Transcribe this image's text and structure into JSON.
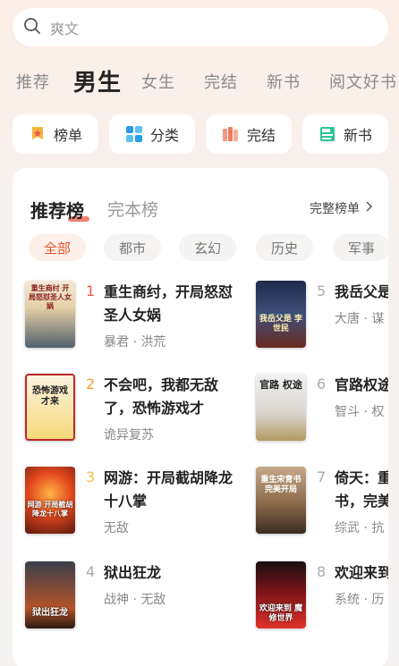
{
  "search": {
    "placeholder": "爽文"
  },
  "tabs": [
    "推荐",
    "男生",
    "女生",
    "完结",
    "新书",
    "阅文好书"
  ],
  "active_tab": "男生",
  "quick_links": [
    {
      "label": "榜单",
      "icon": "ranking-icon"
    },
    {
      "label": "分类",
      "icon": "category-grid-icon"
    },
    {
      "label": "完结",
      "icon": "finished-books-icon"
    },
    {
      "label": "新书",
      "icon": "new-book-icon"
    }
  ],
  "rank": {
    "tabs": [
      "推荐榜",
      "完本榜"
    ],
    "full_list": "完整榜单",
    "chips": [
      "全部",
      "都市",
      "玄幻",
      "历史",
      "军事"
    ],
    "books": [
      {
        "rank": "1",
        "title": "重生商纣，开局怒怼圣人女娲",
        "tag1": "暴君",
        "tag2": "洪荒",
        "cover_text": "重生商纣 开局怒怼圣人女娲"
      },
      {
        "rank": "2",
        "title": "不会吧，我都无敌了，恐怖游戏才",
        "tag1": "诡异复苏",
        "tag2": "",
        "cover_text": "恐怖游戏 才来"
      },
      {
        "rank": "3",
        "title": "网游：开局截胡降龙十八掌",
        "tag1": "无敌",
        "tag2": "",
        "cover_text": "网游 开局截胡 降龙十八掌"
      },
      {
        "rank": "4",
        "title": "狱出狂龙",
        "tag1": "战神",
        "tag2": "无敌",
        "cover_text": "狱出狂龙"
      },
      {
        "rank": "5",
        "title": "我岳父是",
        "tag1": "大唐",
        "tag2": "谋",
        "cover_text": "我岳父是 李世民"
      },
      {
        "rank": "6",
        "title": "官路权途",
        "tag1": "智斗",
        "tag2": "权",
        "cover_text": "官路 权途"
      },
      {
        "rank": "7",
        "title": "倚天：重书，完美",
        "tag1": "综武",
        "tag2": "抗",
        "cover_text": "重生宋青书 完美开局"
      },
      {
        "rank": "8",
        "title": "欢迎来到",
        "tag1": "系统",
        "tag2": "历",
        "cover_text": "欢迎来到 魔修世界"
      }
    ]
  }
}
